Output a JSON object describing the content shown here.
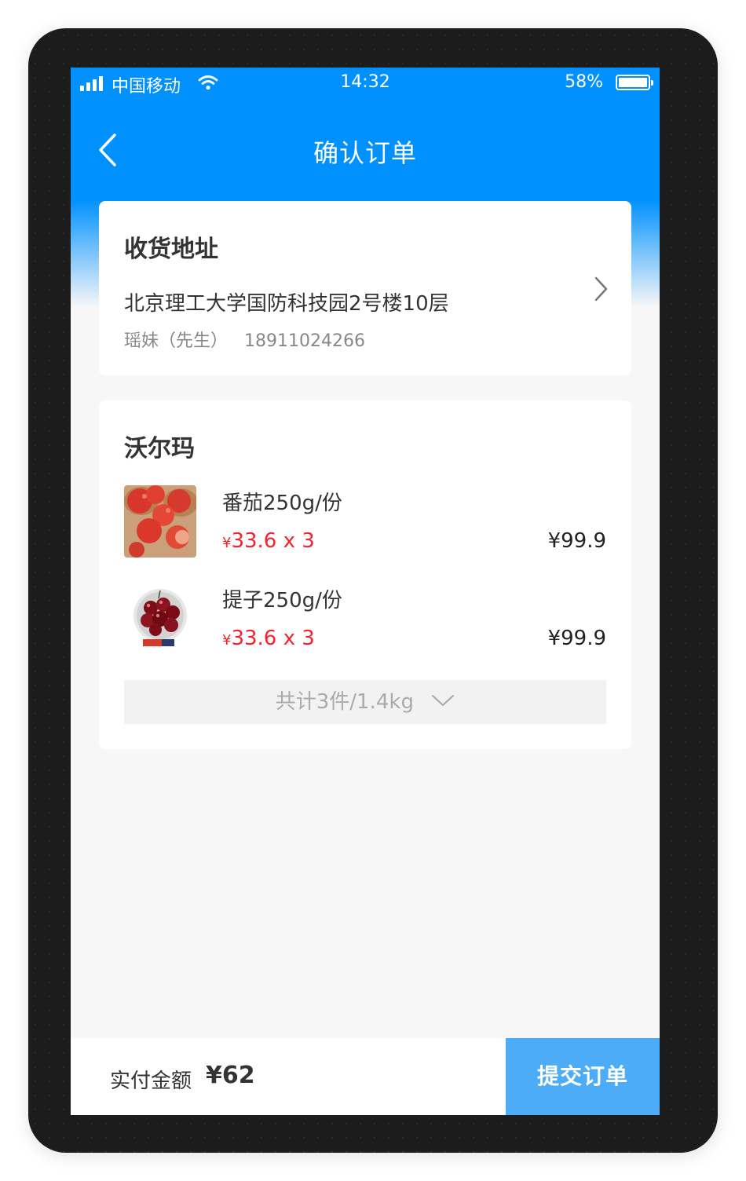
{
  "status_bar": {
    "carrier": "中国移动",
    "time": "14:32",
    "battery_percent": "58%",
    "battery_level": 0.58,
    "icons": [
      "signal-icon",
      "wifi-icon",
      "battery-icon"
    ]
  },
  "header": {
    "title": "确认订单",
    "back_icon": "chevron-left-icon"
  },
  "address": {
    "section_title": "收货地址",
    "line": "北京理工大学国防科技园2号楼10层",
    "contact_name": "瑶妹（先生）",
    "phone": "18911024266",
    "arrow_icon": "chevron-right-icon"
  },
  "store": {
    "name": "沃尔玛",
    "items": [
      {
        "name": "番茄250g/份",
        "currency": "¥",
        "unit_price_qty": "33.6 x 3",
        "subtotal": "¥99.9",
        "image_icon": "tomato-image"
      },
      {
        "name": "提子250g/份",
        "currency": "¥",
        "unit_price_qty": "33.6 x 3",
        "subtotal": "¥99.9",
        "image_icon": "grapes-image"
      }
    ],
    "summary": "共计3件/1.4kg",
    "summary_icon": "chevron-down-icon"
  },
  "footer": {
    "total_label": "实付金额",
    "total_amount": "¥62",
    "submit_label": "提交订单"
  },
  "colors": {
    "primary": "#0091ff",
    "price_red": "#f5222d",
    "submit_button": "#4cacf7",
    "page_background": "#f7f7f7"
  }
}
